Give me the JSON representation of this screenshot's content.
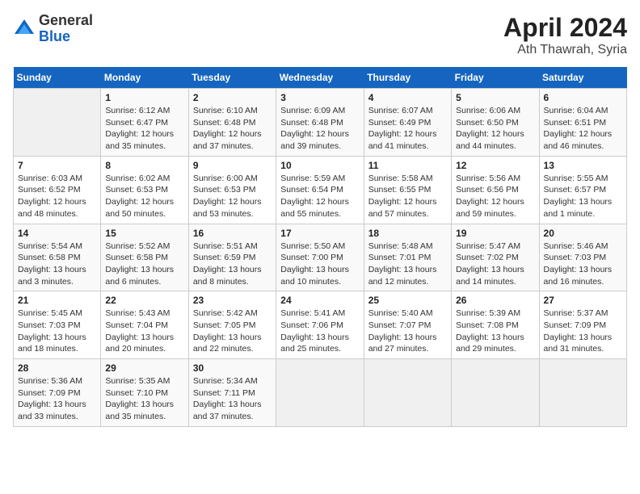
{
  "header": {
    "logo_general": "General",
    "logo_blue": "Blue",
    "title": "April 2024",
    "subtitle": "Ath Thawrah, Syria"
  },
  "columns": [
    "Sunday",
    "Monday",
    "Tuesday",
    "Wednesday",
    "Thursday",
    "Friday",
    "Saturday"
  ],
  "weeks": [
    [
      {
        "day": "",
        "detail": ""
      },
      {
        "day": "1",
        "detail": "Sunrise: 6:12 AM\nSunset: 6:47 PM\nDaylight: 12 hours\nand 35 minutes."
      },
      {
        "day": "2",
        "detail": "Sunrise: 6:10 AM\nSunset: 6:48 PM\nDaylight: 12 hours\nand 37 minutes."
      },
      {
        "day": "3",
        "detail": "Sunrise: 6:09 AM\nSunset: 6:48 PM\nDaylight: 12 hours\nand 39 minutes."
      },
      {
        "day": "4",
        "detail": "Sunrise: 6:07 AM\nSunset: 6:49 PM\nDaylight: 12 hours\nand 41 minutes."
      },
      {
        "day": "5",
        "detail": "Sunrise: 6:06 AM\nSunset: 6:50 PM\nDaylight: 12 hours\nand 44 minutes."
      },
      {
        "day": "6",
        "detail": "Sunrise: 6:04 AM\nSunset: 6:51 PM\nDaylight: 12 hours\nand 46 minutes."
      }
    ],
    [
      {
        "day": "7",
        "detail": "Sunrise: 6:03 AM\nSunset: 6:52 PM\nDaylight: 12 hours\nand 48 minutes."
      },
      {
        "day": "8",
        "detail": "Sunrise: 6:02 AM\nSunset: 6:53 PM\nDaylight: 12 hours\nand 50 minutes."
      },
      {
        "day": "9",
        "detail": "Sunrise: 6:00 AM\nSunset: 6:53 PM\nDaylight: 12 hours\nand 53 minutes."
      },
      {
        "day": "10",
        "detail": "Sunrise: 5:59 AM\nSunset: 6:54 PM\nDaylight: 12 hours\nand 55 minutes."
      },
      {
        "day": "11",
        "detail": "Sunrise: 5:58 AM\nSunset: 6:55 PM\nDaylight: 12 hours\nand 57 minutes."
      },
      {
        "day": "12",
        "detail": "Sunrise: 5:56 AM\nSunset: 6:56 PM\nDaylight: 12 hours\nand 59 minutes."
      },
      {
        "day": "13",
        "detail": "Sunrise: 5:55 AM\nSunset: 6:57 PM\nDaylight: 13 hours\nand 1 minute."
      }
    ],
    [
      {
        "day": "14",
        "detail": "Sunrise: 5:54 AM\nSunset: 6:58 PM\nDaylight: 13 hours\nand 3 minutes."
      },
      {
        "day": "15",
        "detail": "Sunrise: 5:52 AM\nSunset: 6:58 PM\nDaylight: 13 hours\nand 6 minutes."
      },
      {
        "day": "16",
        "detail": "Sunrise: 5:51 AM\nSunset: 6:59 PM\nDaylight: 13 hours\nand 8 minutes."
      },
      {
        "day": "17",
        "detail": "Sunrise: 5:50 AM\nSunset: 7:00 PM\nDaylight: 13 hours\nand 10 minutes."
      },
      {
        "day": "18",
        "detail": "Sunrise: 5:48 AM\nSunset: 7:01 PM\nDaylight: 13 hours\nand 12 minutes."
      },
      {
        "day": "19",
        "detail": "Sunrise: 5:47 AM\nSunset: 7:02 PM\nDaylight: 13 hours\nand 14 minutes."
      },
      {
        "day": "20",
        "detail": "Sunrise: 5:46 AM\nSunset: 7:03 PM\nDaylight: 13 hours\nand 16 minutes."
      }
    ],
    [
      {
        "day": "21",
        "detail": "Sunrise: 5:45 AM\nSunset: 7:03 PM\nDaylight: 13 hours\nand 18 minutes."
      },
      {
        "day": "22",
        "detail": "Sunrise: 5:43 AM\nSunset: 7:04 PM\nDaylight: 13 hours\nand 20 minutes."
      },
      {
        "day": "23",
        "detail": "Sunrise: 5:42 AM\nSunset: 7:05 PM\nDaylight: 13 hours\nand 22 minutes."
      },
      {
        "day": "24",
        "detail": "Sunrise: 5:41 AM\nSunset: 7:06 PM\nDaylight: 13 hours\nand 25 minutes."
      },
      {
        "day": "25",
        "detail": "Sunrise: 5:40 AM\nSunset: 7:07 PM\nDaylight: 13 hours\nand 27 minutes."
      },
      {
        "day": "26",
        "detail": "Sunrise: 5:39 AM\nSunset: 7:08 PM\nDaylight: 13 hours\nand 29 minutes."
      },
      {
        "day": "27",
        "detail": "Sunrise: 5:37 AM\nSunset: 7:09 PM\nDaylight: 13 hours\nand 31 minutes."
      }
    ],
    [
      {
        "day": "28",
        "detail": "Sunrise: 5:36 AM\nSunset: 7:09 PM\nDaylight: 13 hours\nand 33 minutes."
      },
      {
        "day": "29",
        "detail": "Sunrise: 5:35 AM\nSunset: 7:10 PM\nDaylight: 13 hours\nand 35 minutes."
      },
      {
        "day": "30",
        "detail": "Sunrise: 5:34 AM\nSunset: 7:11 PM\nDaylight: 13 hours\nand 37 minutes."
      },
      {
        "day": "",
        "detail": ""
      },
      {
        "day": "",
        "detail": ""
      },
      {
        "day": "",
        "detail": ""
      },
      {
        "day": "",
        "detail": ""
      }
    ]
  ]
}
